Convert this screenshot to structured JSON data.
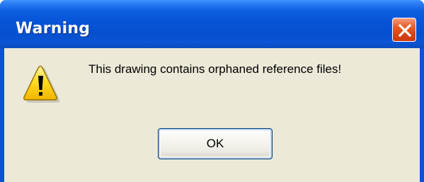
{
  "dialog": {
    "title": "Warning",
    "message": "This drawing contains orphaned reference files!",
    "ok_label": "OK",
    "icon": "warning-icon"
  },
  "colors": {
    "titlebar": "#0754d8",
    "client": "#ece9d8",
    "close_button": "#d74418",
    "icon_fill": "#ffd81a"
  }
}
